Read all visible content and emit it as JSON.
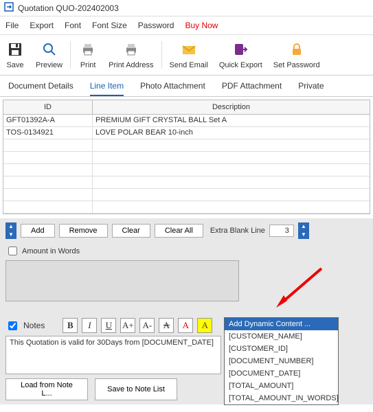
{
  "title": "Quotation QUO-202402003",
  "menu": [
    "File",
    "Export",
    "Font",
    "Font Size",
    "Password",
    "Buy Now"
  ],
  "toolbar": [
    {
      "name": "save",
      "label": "Save"
    },
    {
      "name": "preview",
      "label": "Preview"
    },
    {
      "name": "print",
      "label": "Print"
    },
    {
      "name": "printaddr",
      "label": "Print Address"
    },
    {
      "name": "sendemail",
      "label": "Send Email"
    },
    {
      "name": "quickexport",
      "label": "Quick Export"
    },
    {
      "name": "setpassword",
      "label": "Set Password"
    }
  ],
  "tabs": [
    "Document Details",
    "Line Item",
    "Photo Attachment",
    "PDF Attachment",
    "Private"
  ],
  "active_tab": "Line Item",
  "table": {
    "headers": [
      "ID",
      "Description"
    ],
    "rows": [
      {
        "id": "GFT01392A-A",
        "desc": "PREMIUM GIFT CRYSTAL BALL Set A"
      },
      {
        "id": "TOS-0134921",
        "desc": "LOVE POLAR BEAR 10-inch"
      }
    ]
  },
  "buttons": {
    "add": "Add",
    "remove": "Remove",
    "clear": "Clear",
    "clearall": "Clear All"
  },
  "extra_blank_label": "Extra Blank Line",
  "extra_blank_value": "3",
  "amount_in_words_label": "Amount in Words",
  "notes_label": "Notes",
  "formatting": [
    "B",
    "I",
    "U",
    "A+",
    "A-",
    "A",
    "A",
    "A"
  ],
  "dynamic_placeholder": "Add Dynamic Content ...",
  "note_text": "This Quotation is valid for 30Days from [DOCUMENT_DATE]",
  "load_note": "Load from Note L...",
  "save_note": "Save to Note List",
  "dropdown_options": [
    "Add Dynamic Content ...",
    "[CUSTOMER_NAME]",
    "[CUSTOMER_ID]",
    "[DOCUMENT_NUMBER]",
    "[DOCUMENT_DATE]",
    "[TOTAL_AMOUNT]",
    "[TOTAL_AMOUNT_IN_WORDS]"
  ]
}
